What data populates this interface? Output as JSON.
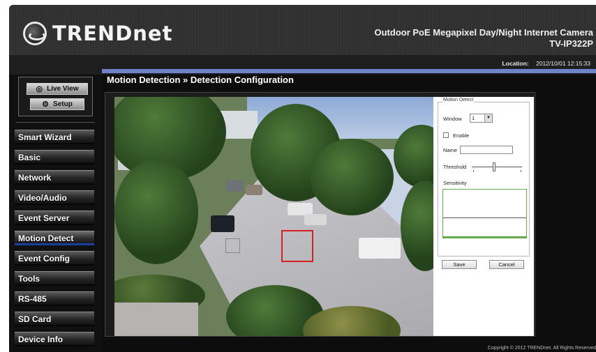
{
  "brand": {
    "name": "TRENDnet"
  },
  "product": {
    "line1": "Outdoor PoE Megapixel Day/Night Internet Camera",
    "model": "TV-IP322P"
  },
  "location": {
    "label": "Location:",
    "datetime": "2012/10/01 12:15:33"
  },
  "quick": {
    "live_view": "Live View",
    "setup": "Setup",
    "live_icon": "eye-icon",
    "setup_icon": "gears-icon"
  },
  "nav": [
    "Smart Wizard",
    "Basic",
    "Network",
    "Video/Audio",
    "Event Server",
    "Motion Detect",
    "Event Config",
    "Tools",
    "RS-485",
    "SD Card",
    "Device Info"
  ],
  "nav_active": "Motion Detect",
  "page": {
    "title": "Motion Detection » Detection Configuration"
  },
  "panel": {
    "legend": "Motion Detect",
    "window_label": "Window",
    "window_value": "1",
    "enable_label": "Enable",
    "enable_checked": false,
    "name_label": "Name",
    "name_value": "",
    "threshold_label": "Threshold",
    "sensitivity_label": "Sensitivity",
    "save": "Save",
    "cancel": "Cancel"
  },
  "footer": {
    "copyright": "Copyright © 2012 TRENDnet. All Rights Reserved"
  },
  "colors": {
    "accent_bar": "#6f83c9",
    "active_underline": "#1a3ea0",
    "detection_box": "#d42020"
  }
}
